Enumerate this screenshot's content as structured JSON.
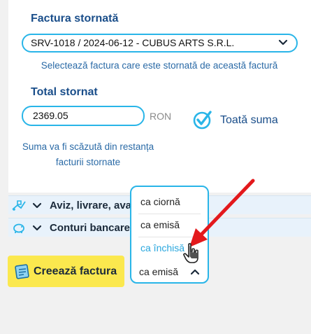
{
  "invoice_section": {
    "title": "Factura stornată",
    "selected_invoice": "SRV-1018 / 2024-06-12 - CUBUS ARTS S.R.L.",
    "hint": "Selectează factura care este stornată de această factură"
  },
  "total_section": {
    "title": "Total stornat",
    "amount": "2369.05",
    "currency": "RON",
    "full_sum_label": "Toată suma",
    "note_line1": "Suma va fi scăzută din restanța",
    "note_line2": "facturii stornate"
  },
  "sections": [
    {
      "label": "Aviz, livrare, ava",
      "icon": "delivery-icon"
    },
    {
      "label": "Conturi bancare",
      "icon": "piggy-bank-icon"
    }
  ],
  "create_button": {
    "label": "Creează factura",
    "icon": "invoice-icon"
  },
  "status_dropdown": {
    "options": [
      "ca ciornă",
      "ca emisă",
      "ca închisă"
    ],
    "highlighted": "ca închisă",
    "current": "ca emisă"
  },
  "colors": {
    "accent": "#29b5e8",
    "heading": "#1a4e8a",
    "button": "#fbe84e",
    "annotation_arrow": "#e3191c"
  }
}
